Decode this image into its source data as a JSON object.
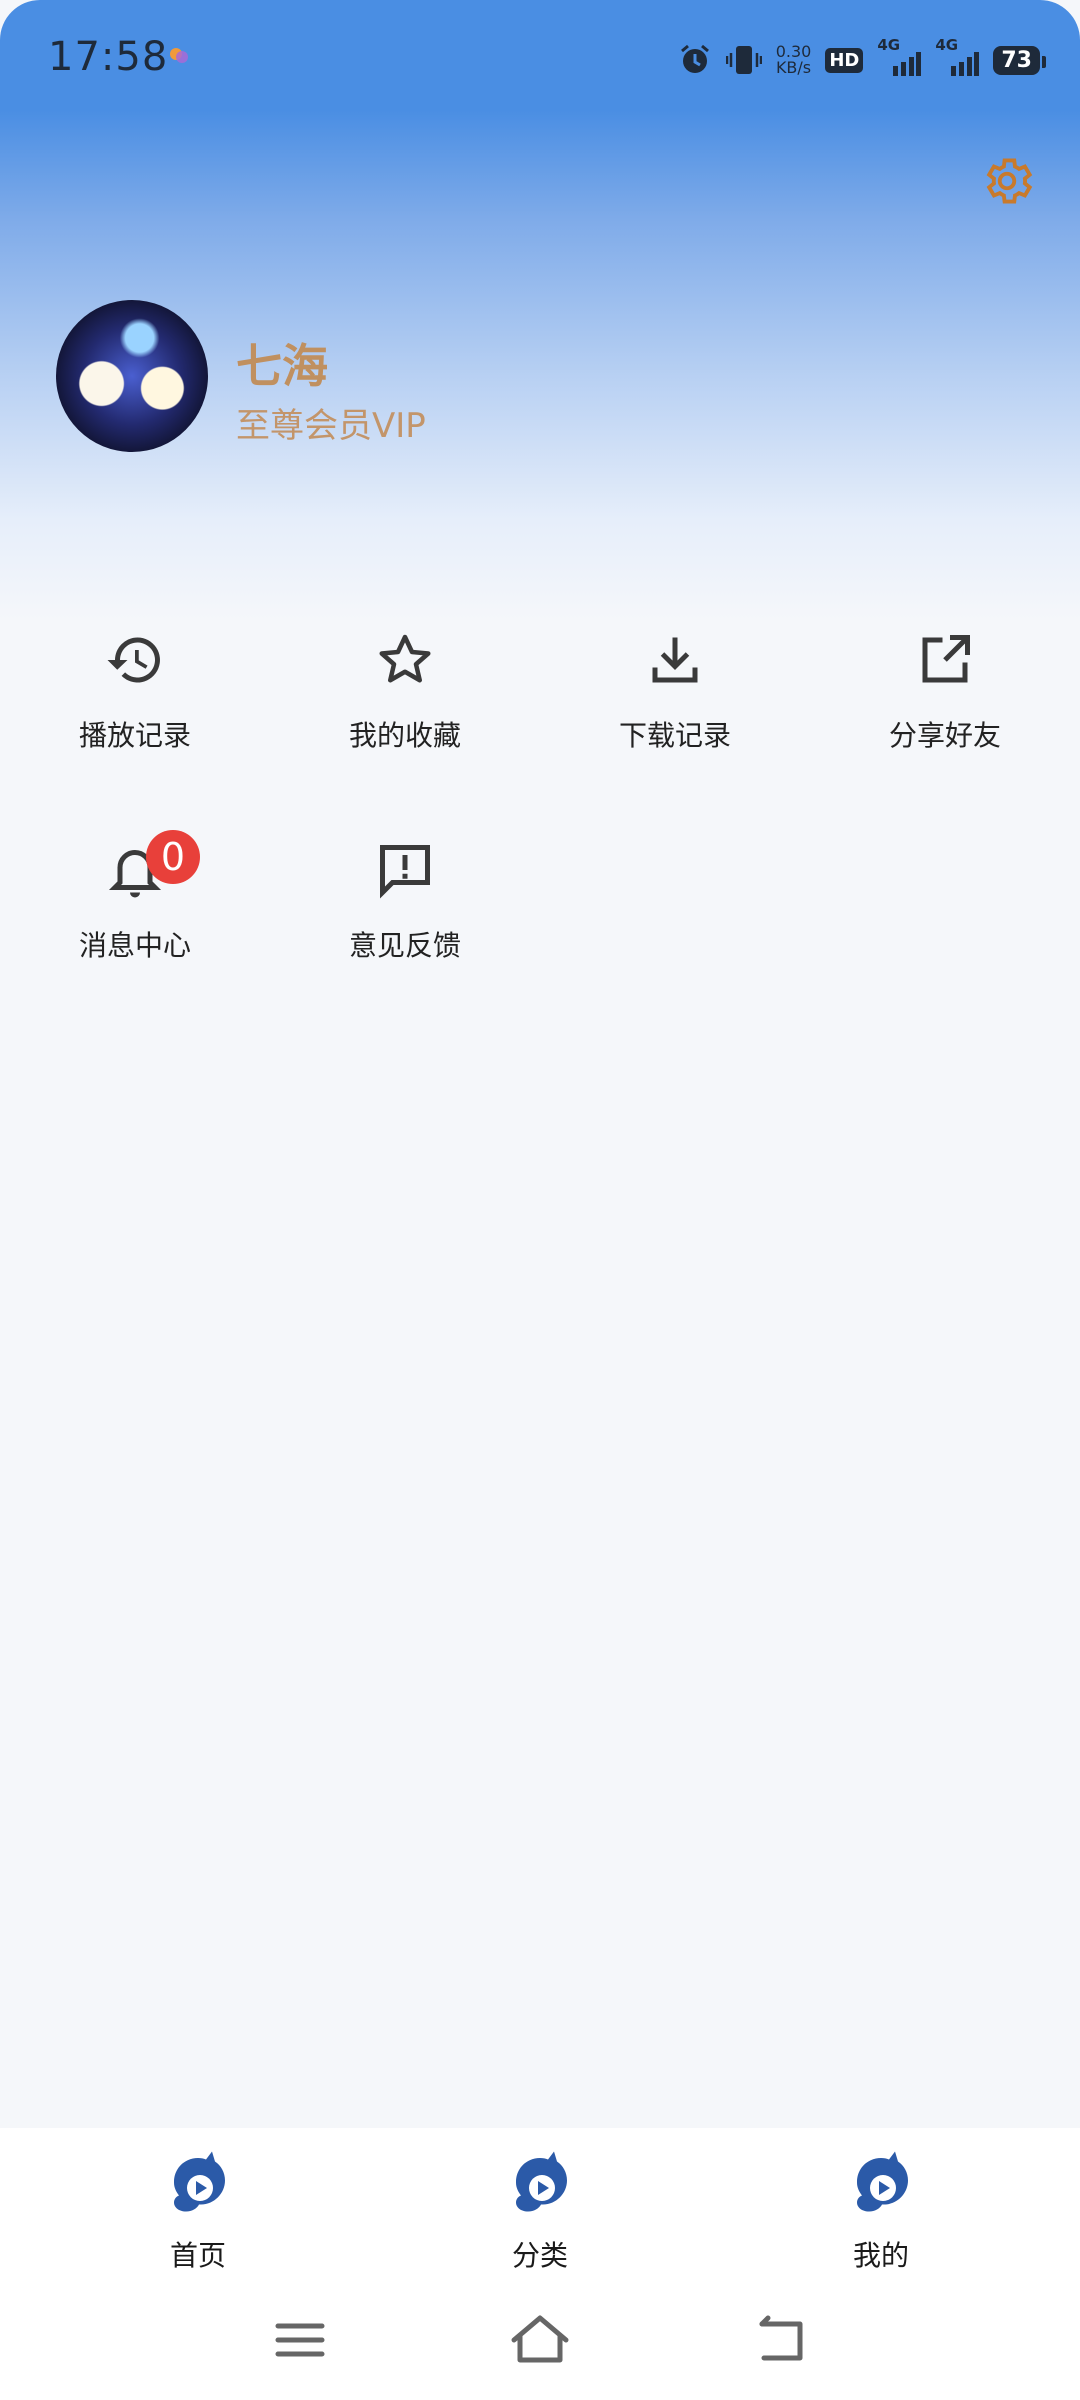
{
  "status_bar": {
    "time": "17:58",
    "net_speed_value": "0.30",
    "net_speed_unit": "KB/s",
    "hd_label": "HD",
    "signal_1_label": "4G",
    "signal_2_label": "4G",
    "battery": "73"
  },
  "profile": {
    "username": "七海",
    "membership": "至尊会员VIP"
  },
  "menu": {
    "history": "播放记录",
    "favorites": "我的收藏",
    "downloads": "下载记录",
    "share": "分享好友",
    "messages": "消息中心",
    "message_count": "0",
    "feedback": "意见反馈"
  },
  "bottom_nav": {
    "home": "首页",
    "category": "分类",
    "mine": "我的"
  },
  "colors": {
    "header_blue": "#4a8ee3",
    "vip_gold": "#c3956a",
    "badge_red": "#e8403a",
    "nav_icon_blue": "#2b5aa8"
  }
}
